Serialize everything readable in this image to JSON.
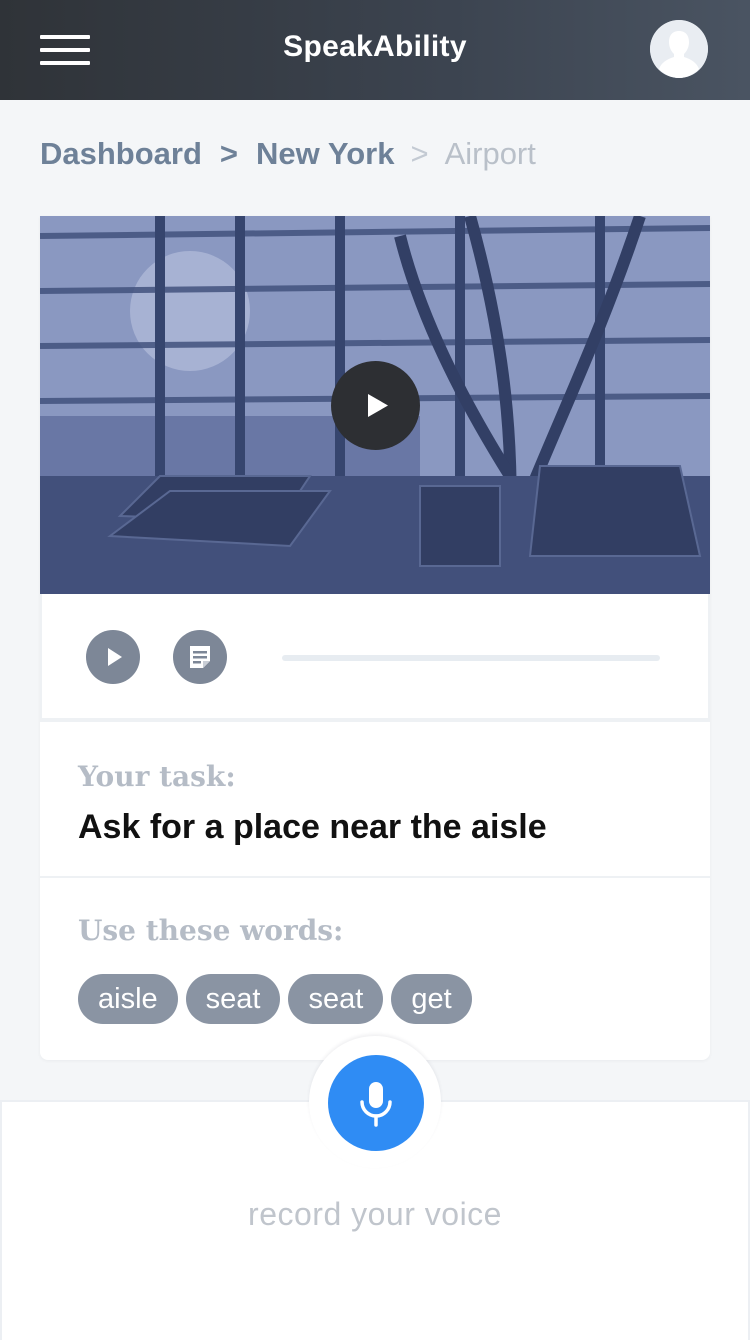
{
  "header": {
    "title": "SpeakAbility",
    "menu_icon": "hamburger-menu-icon",
    "avatar_icon": "user-avatar-icon"
  },
  "breadcrumb": {
    "items": [
      "Dashboard",
      "New York",
      "Airport"
    ],
    "separator": ">"
  },
  "video": {
    "thumbnail_subject": "airport departure lounge",
    "play_icon": "play-icon"
  },
  "controls": {
    "audio_play_icon": "play-icon",
    "transcript_icon": "notes-icon",
    "progress": 0
  },
  "task": {
    "label": "Your task:",
    "text": "Ask for a place near the aisle"
  },
  "words": {
    "label": "Use these words:",
    "chips": [
      "aisle",
      "seat",
      "seat",
      "get"
    ]
  },
  "recorder": {
    "label": "record your voice",
    "mic_icon": "microphone-icon"
  },
  "colors": {
    "accent": "#2f8cf4",
    "chip": "#8a94a3",
    "header": "#2f3338",
    "muted_label": "#b5bcc6"
  }
}
